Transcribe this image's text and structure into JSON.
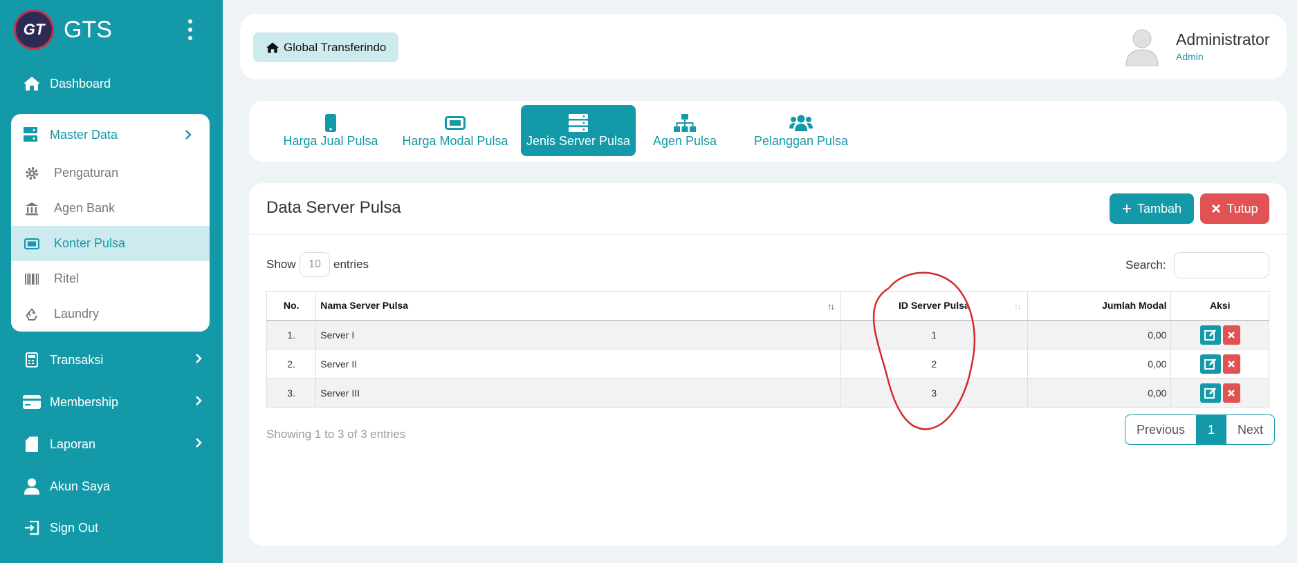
{
  "brand": {
    "name": "GTS",
    "logo_text": "GT"
  },
  "nav": {
    "dashboard": "Dashboard",
    "master_data": "Master Data",
    "submenu": [
      "Pengaturan",
      "Agen Bank",
      "Konter Pulsa",
      "Ritel",
      "Laundry"
    ],
    "transaksi": "Transaksi",
    "membership": "Membership",
    "laporan": "Laporan",
    "akun_saya": "Akun Saya",
    "sign_out": "Sign Out"
  },
  "header": {
    "breadcrumb": "Global Transferindo",
    "user_name": "Administrator",
    "user_role": "Admin"
  },
  "tabs": [
    "Harga Jual Pulsa",
    "Harga Modal Pulsa",
    "Jenis Server Pulsa",
    "Agen Pulsa",
    "Pelanggan Pulsa"
  ],
  "active_tab": "Jenis Server Pulsa",
  "card": {
    "title": "Data Server Pulsa",
    "add_label": "Tambah",
    "close_label": "Tutup"
  },
  "table_controls": {
    "show": "Show",
    "entries_value": "10",
    "entries": "entries",
    "search": "Search:"
  },
  "table": {
    "headers": [
      "No.",
      "Nama Server Pulsa",
      "ID Server Pulsa",
      "Jumlah Modal",
      "Aksi"
    ],
    "rows": [
      {
        "no": "1.",
        "name": "Server I",
        "id": "1",
        "modal": "0,00"
      },
      {
        "no": "2.",
        "name": "Server II",
        "id": "2",
        "modal": "0,00"
      },
      {
        "no": "3.",
        "name": "Server III",
        "id": "3",
        "modal": "0,00"
      }
    ]
  },
  "footer": {
    "info": "Showing 1 to 3 of 3 entries",
    "previous": "Previous",
    "page": "1",
    "next": "Next"
  },
  "colors": {
    "primary": "#1499a8",
    "danger": "#e05254",
    "annotation": "#d42a2a"
  }
}
